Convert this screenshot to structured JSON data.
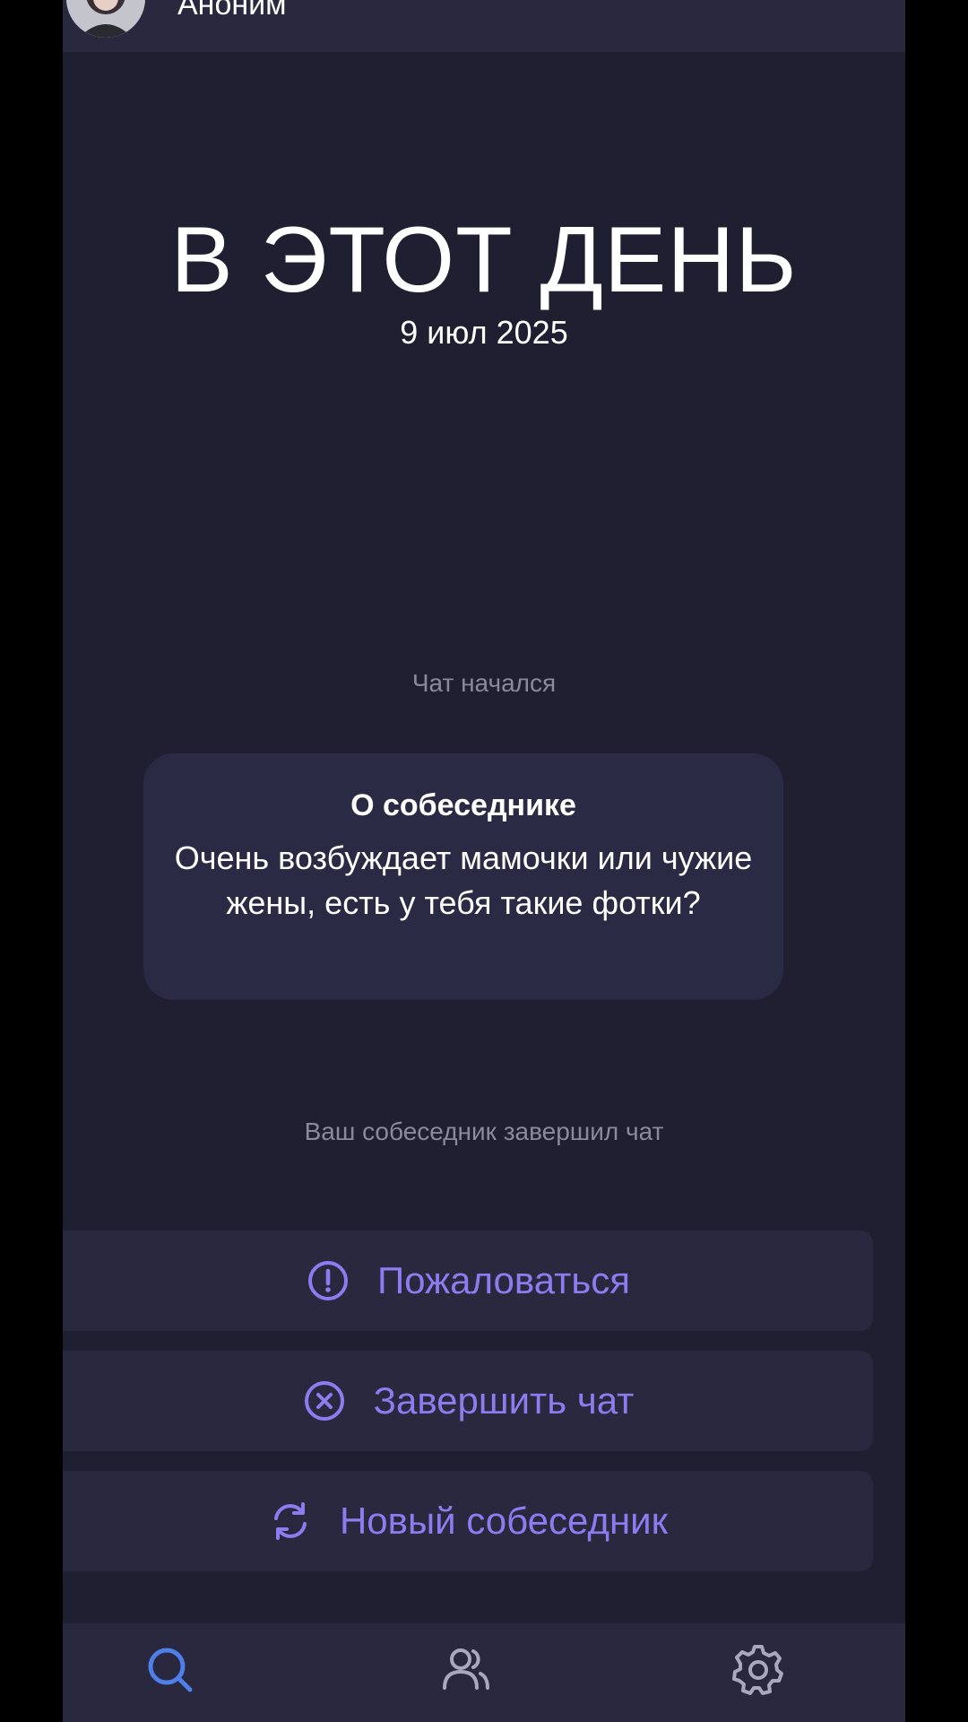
{
  "header": {
    "user_name": "Аноним"
  },
  "day": {
    "title": "В ЭТОТ ДЕНЬ",
    "date": "9 июл 2025"
  },
  "chat": {
    "started_text": "Чат начался",
    "about": {
      "title": "О собеседнике",
      "text": "Очень возбуждает мамочки или чужие жены, есть у тебя такие фотки?"
    },
    "ended_text": "Ваш собеседник завершил чат"
  },
  "actions": {
    "report": {
      "label": "Пожаловаться",
      "icon": "alert-circle-icon"
    },
    "end_chat": {
      "label": "Завершить чат",
      "icon": "x-circle-icon"
    },
    "new_partner": {
      "label": "Новый собеседник",
      "icon": "refresh-icon"
    }
  },
  "nav": {
    "items": [
      {
        "icon": "search-icon",
        "active": true
      },
      {
        "icon": "people-icon",
        "active": false
      },
      {
        "icon": "gear-icon",
        "active": false
      }
    ]
  },
  "colors": {
    "background": "#1f1f31",
    "panel": "#29283f",
    "card": "#2b2a45",
    "accent": "#8d7cf0",
    "active_nav": "#4f7fe8",
    "muted_text": "#8a899e"
  }
}
